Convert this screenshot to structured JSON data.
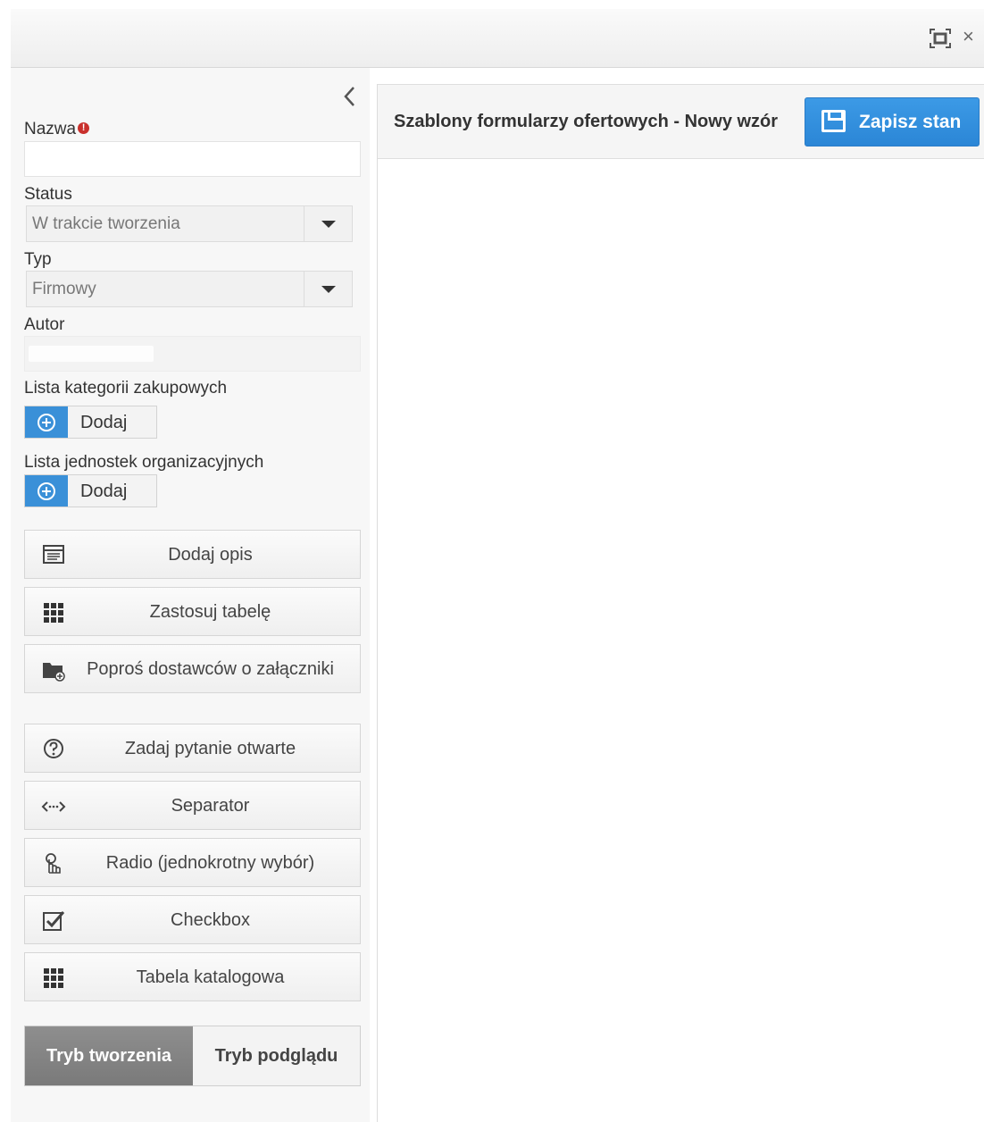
{
  "window": {
    "maximize_icon": "maximize-icon",
    "close_label": "×"
  },
  "form": {
    "name_label": "Nazwa",
    "name_value": "",
    "required_icon": "!",
    "status_label": "Status",
    "status_value": "W trakcie tworzenia",
    "type_label": "Typ",
    "type_value": "Firmowy",
    "author_label": "Autor",
    "author_value": "",
    "categories_label": "Lista kategorii zakupowych",
    "categories_add": "Dodaj",
    "units_label": "Lista jednostek organizacyjnych",
    "units_add": "Dodaj"
  },
  "tools": [
    {
      "label": "Dodaj opis",
      "icon": "document-icon"
    },
    {
      "label": "Zastosuj tabelę",
      "icon": "grid-icon"
    },
    {
      "label": "Poproś dostawców o załączniki",
      "icon": "folder-add-icon"
    },
    {
      "label": "Zadaj pytanie otwarte",
      "icon": "question-icon"
    },
    {
      "label": "Separator",
      "icon": "separator-icon"
    },
    {
      "label": "Radio (jednokrotny wybór)",
      "icon": "pointer-icon"
    },
    {
      "label": "Checkbox",
      "icon": "checkbox-icon"
    },
    {
      "label": "Tabela katalogowa",
      "icon": "grid-icon"
    }
  ],
  "modes": {
    "create": "Tryb tworzenia",
    "preview": "Tryb podglądu"
  },
  "header": {
    "title": "Szablony formularzy ofertowych - Nowy wzór",
    "save_label": "Zapisz stan"
  },
  "colors": {
    "accent": "#2b86d6",
    "required": "#c9302c",
    "active_mode": "#828282"
  }
}
